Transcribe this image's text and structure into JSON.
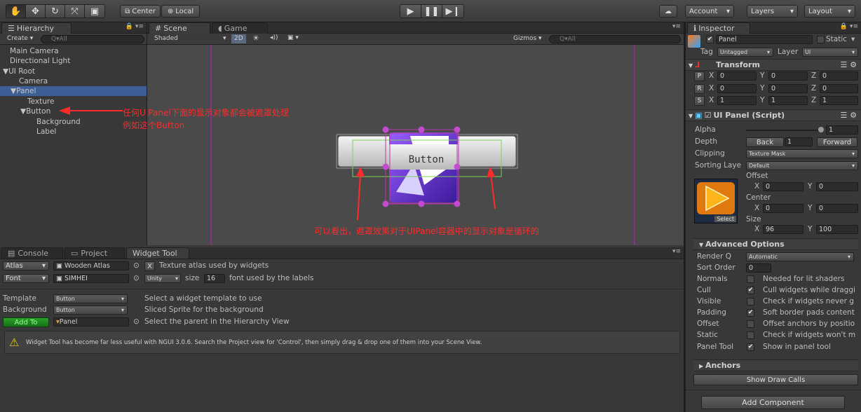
{
  "toolbar": {
    "pivot_center": "Center",
    "pivot_local": "Local",
    "account": "Account",
    "layers": "Layers",
    "layout": "Layout"
  },
  "hierarchy": {
    "tab": "Hierarchy",
    "create": "Create",
    "search_placeholder": "Q▾All",
    "items": [
      "Main Camera",
      "Directional Light",
      "UI Root",
      "Camera",
      "Panel",
      "Texture",
      "Button",
      "Background",
      "Label"
    ]
  },
  "scene": {
    "tab_scene": "Scene",
    "tab_game": "Game",
    "shaded": "Shaded",
    "mode_2d": "2D",
    "gizmos": "Gizmos",
    "search_placeholder": "Q▾All",
    "button_label": "Button",
    "annotation_1_line1": "任何UIPanel下面的显示对象都会被遮罩处理",
    "annotation_1_line2": "例如这个Button",
    "annotation_2": "可以看出，遮罩效果对于UIPanel容器中的显示对象是循环的"
  },
  "bottom": {
    "tab_console": "Console",
    "tab_project": "Project",
    "tab_widget": "Widget Tool",
    "atlas_label": "Atlas",
    "atlas_value": "Wooden Atlas",
    "atlas_desc": "Texture atlas used by widgets",
    "font_label": "Font",
    "font_value": "SIMHEI",
    "font_type": "Unity",
    "size_label": "size",
    "size_value": "16",
    "font_desc": "font used by the labels",
    "template_label": "Template",
    "template_value": "Button",
    "template_desc": "Select a widget template to use",
    "background_label": "Background",
    "background_value": "Button",
    "background_desc": "Sliced Sprite for the background",
    "add_to": "Add To",
    "parent_value": "Panel",
    "parent_desc": "Select the parent in the Hierarchy View",
    "warning": "Widget Tool has become far less useful with NGUI 3.0.6. Search the Project view for 'Control', then simply drag & drop one of them into your Scene View."
  },
  "inspector": {
    "tab": "Inspector",
    "object_name": "Panel",
    "static": "Static",
    "tag_label": "Tag",
    "tag_value": "Untagged",
    "layer_label": "Layer",
    "layer_value": "UI",
    "transform": "Transform",
    "p": "P",
    "r": "R",
    "s": "S",
    "pos": {
      "x": "0",
      "y": "0",
      "z": "0"
    },
    "rot": {
      "x": "0",
      "y": "0",
      "z": "0"
    },
    "scale": {
      "x": "1",
      "y": "1",
      "z": "1"
    },
    "axis_x": "X",
    "axis_y": "Y",
    "axis_z": "Z",
    "uipanel": "UI Panel (Script)",
    "alpha_label": "Alpha",
    "alpha_value": "1",
    "depth_label": "Depth",
    "back": "Back",
    "depth_value": "1",
    "forward": "Forward",
    "clipping_label": "Clipping",
    "clipping_value": "Texture Mask",
    "sorting_label": "Sorting Laye",
    "sorting_value": "Default",
    "offset_label": "Offset",
    "offset": {
      "x": "0",
      "y": "0"
    },
    "center_label": "Center",
    "center": {
      "x": "0",
      "y": "0"
    },
    "size_label": "Size",
    "size": {
      "x": "96",
      "y": "100"
    },
    "select": "Select",
    "advanced": "Advanced Options",
    "renderq_label": "Render Q",
    "renderq_value": "Automatic",
    "sortorder_label": "Sort Order",
    "sortorder_value": "0",
    "options": [
      {
        "label": "Normals",
        "checked": "",
        "desc": "Needed for lit shaders"
      },
      {
        "label": "Cull",
        "checked": "✔",
        "desc": "Cull widgets while draggi"
      },
      {
        "label": "Visible",
        "checked": "",
        "desc": "Check if widgets never g"
      },
      {
        "label": "Padding",
        "checked": "✔",
        "desc": "Soft border pads content"
      },
      {
        "label": "Offset",
        "checked": "",
        "desc": "Offset anchors by positio"
      },
      {
        "label": "Static",
        "checked": "",
        "desc": "Check if widgets won't m"
      },
      {
        "label": "Panel Tool",
        "checked": "✔",
        "desc": "Show in panel tool"
      }
    ],
    "anchors": "Anchors",
    "show_draw_calls": "Show Draw Calls",
    "add_component": "Add Component"
  }
}
